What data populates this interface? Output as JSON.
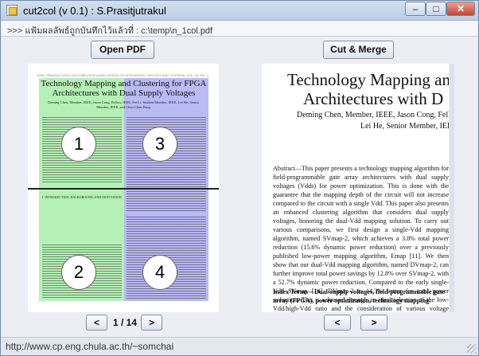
{
  "window": {
    "title": "cut2col (v 0.1) : S.Prasitjutrakul",
    "minimize": "–",
    "maximize": "□",
    "close": "✕"
  },
  "path_bar": {
    "text": ">>> แฟ้มผลลัพธ์ถูกบันทึกไว้แล้วที่ : c:\\temp\\n_1col.pdf"
  },
  "toolbar": {
    "open_label": "Open PDF",
    "cut_label": "Cut & Merge"
  },
  "left_page": {
    "header": "IEEE TRANSACTIONS ON COMPUTER-AIDED DESIGN OF INTEGRATED CIRCUITS AND SYSTEMS, VOL. 24, NO. 4, APRIL 2005",
    "title": "Technology Mapping and Clustering for FPGA Architectures with Dual Supply Voltages",
    "authors": "Deming Chen, Member, IEEE, Jason Cong, Fellow, IEEE, Fei Li, Student Member, IEEE, Lei He, Senior Member, IEEE, and Chen-Chen Peng",
    "section": "I. INTRODUCTION, BACKGROUND, AND MOTIVATION",
    "region_numbers": [
      "1",
      "2",
      "3",
      "4"
    ]
  },
  "right_page": {
    "title_line1": "Technology Mapping an",
    "title_line2": "Architectures with D",
    "authors_line1": "Deming Chen, Member, IEEE, Jason Cong, Fell",
    "authors_line2": "Lei He, Senior Member, IEEE, Fei Li,",
    "abstract": "Abstract—This paper presents a technology mapping algorithm for field-programmable gate array architectures with dual supply voltages (Vdds) for power optimization. This is done with the guarantee that the mapping depth of the circuit will not increase compared to the circuit with a single Vdd. This paper also presents an enhanced clustering algorithm that considers dual supply voltages, honoring the dual-Vdd mapping solution. To carry out various comparisons, we first design a single-Vdd mapping algorithm, named SVmap-2, which achieves a 3.8% total power reduction (15.6% dynamic power reduction) over a previously published low-power mapping algorithm, Emap [11]. We then show that our dual-Vdd mapping algorithm, named DVmap-2, can further improve total power savings by 12.8% over SVmap-2, with a 52.7% dynamic power reduction. Compared to the early single-Vdd SVmap [14], DVmap-2 is 14.3% better for total power reduction. This is achieved through an ideal selection of the low-Vdd/high-Vdd ratio and the consideration of various voltage changing scenarios during the mapping process.",
    "index_terms": "Index Terms—Dual-supply voltages, field-programmable gate array (FPGA), power optimization, technology mapping."
  },
  "navigation": {
    "prev_label": "<",
    "next_label": ">",
    "page_indicator": "1 / 14"
  },
  "status": {
    "text": "http://www.cp.eng.chula.ac.th/~somchai"
  },
  "colors": {
    "left_region": "#78e678",
    "right_region": "#8c8cf0",
    "window_border": "#6f8bad"
  }
}
